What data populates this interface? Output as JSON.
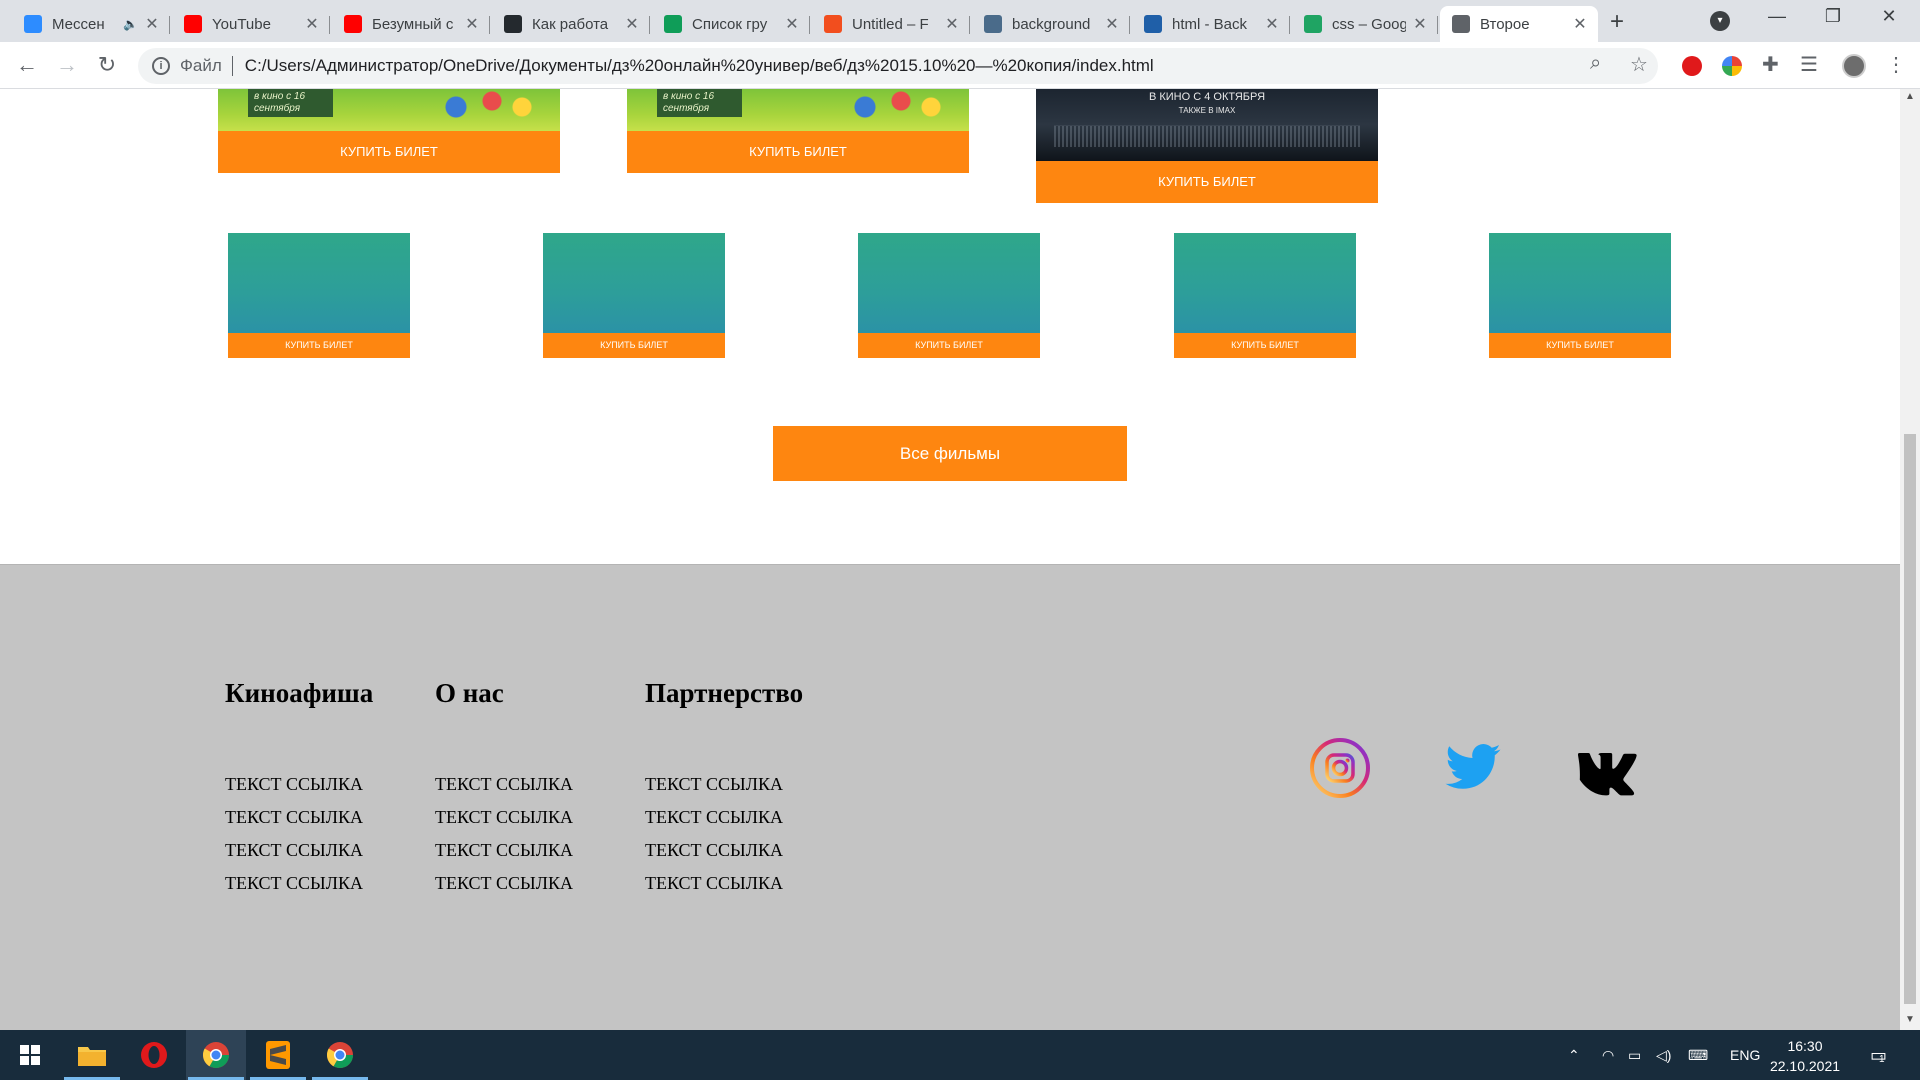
{
  "browser": {
    "tabs": [
      {
        "title": "Мессен",
        "icon": "messenger-icon",
        "color": "#2d8cff",
        "muted": true
      },
      {
        "title": "YouTube",
        "icon": "youtube-icon",
        "color": "#ff0000"
      },
      {
        "title": "Безумный с",
        "icon": "youtube-icon",
        "color": "#ff0000"
      },
      {
        "title": "Как работа",
        "icon": "github-icon",
        "color": "#24292e"
      },
      {
        "title": "Список гру",
        "icon": "sheets-icon",
        "color": "#0f9d58"
      },
      {
        "title": "Untitled – F",
        "icon": "figma-icon",
        "color": "#f24e1e"
      },
      {
        "title": "background",
        "icon": "gear-icon",
        "color": "#4a6b8a"
      },
      {
        "title": "html - Back",
        "icon": "stackoverflow-icon",
        "color": "#1f5fa8"
      },
      {
        "title": "css – Googl",
        "icon": "drive-icon",
        "color": "#1fa463"
      },
      {
        "title": "Второе",
        "icon": "globe-icon",
        "color": "#5f6368",
        "active": true
      }
    ],
    "new_tab": "+",
    "address": {
      "label": "Файл",
      "url": "C:/Users/Администратор/OneDrive/Документы/дз%20онлайн%20универ/веб/дз%2015.10%20—%20копия/index.html"
    }
  },
  "page": {
    "posters": [
      {
        "kind": "kids",
        "note": "в кино с 16 сентября",
        "button": "КУПИТЬ БИЛЕТ"
      },
      {
        "kind": "kids",
        "note": "в кино с 16 сентября",
        "button": "КУПИТЬ БИЛЕТ"
      },
      {
        "kind": "dark",
        "line1": "В КИНО С 4 ОКТЯБРЯ",
        "line2": "ТАКЖЕ В IMAX",
        "button": "КУПИТЬ БИЛЕТ"
      }
    ],
    "thumbs": [
      {
        "button": "КУПИТЬ БИЛЕТ"
      },
      {
        "button": "КУПИТЬ БИЛЕТ"
      },
      {
        "button": "КУПИТЬ БИЛЕТ"
      },
      {
        "button": "КУПИТЬ БИЛЕТ"
      },
      {
        "button": "КУПИТЬ БИЛЕТ"
      }
    ],
    "all_films": "Все фильмы",
    "accent_color": "#fe8610",
    "footer": {
      "columns": [
        {
          "title": "Киноафиша",
          "links": [
            "ТЕКСТ ССЫЛКА",
            "ТЕКСТ ССЫЛКА",
            "ТЕКСТ ССЫЛКА",
            "ТЕКСТ ССЫЛКА"
          ]
        },
        {
          "title": "О нас",
          "links": [
            "ТЕКСТ ССЫЛКА",
            "ТЕКСТ ССЫЛКА",
            "ТЕКСТ ССЫЛКА",
            "ТЕКСТ ССЫЛКА"
          ]
        },
        {
          "title": "Партнерство",
          "links": [
            "ТЕКСТ ССЫЛКА",
            "ТЕКСТ ССЫЛКА",
            "ТЕКСТ ССЫЛКА",
            "ТЕКСТ ССЫЛКА"
          ]
        }
      ],
      "social": [
        "instagram-icon",
        "twitter-icon",
        "vk-icon"
      ]
    }
  },
  "taskbar": {
    "apps": [
      "start-icon",
      "file-explorer-icon",
      "opera-icon",
      "chrome-icon",
      "sublime-text-icon",
      "chrome-icon"
    ],
    "language": "ENG",
    "time": "16:30",
    "date": "22.10.2021",
    "notifications": "1"
  }
}
